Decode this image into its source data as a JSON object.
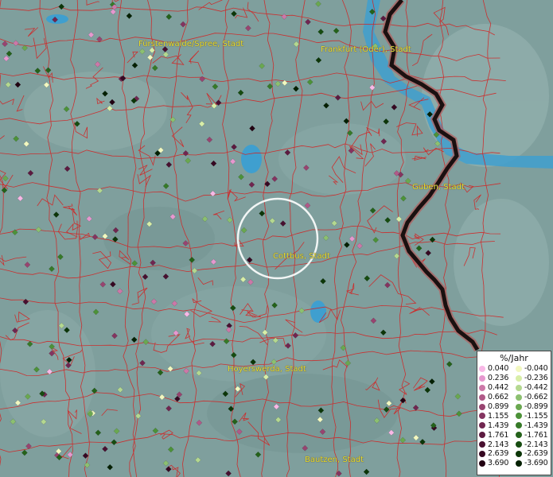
{
  "colors": {
    "background": "#7f9f9d",
    "water": "#3f9fcf",
    "border_line": "#d22424",
    "national_border": "#1a1010",
    "national_border_halo": "#b06060",
    "label": "#e8dd2a",
    "highlight_ring": "#ffffff"
  },
  "cities": [
    {
      "name": "Fürstenwalde/Spree, Stadt"
    },
    {
      "name": "Frankfurt (Oder), Stadt"
    },
    {
      "name": "Guben, Stadt"
    },
    {
      "name": "Cottbus, Stadt"
    },
    {
      "name": "Hoyerswerda, Stadt"
    },
    {
      "name": "Bautzen, Stadt"
    }
  ],
  "legend": {
    "title": "%/Jahr",
    "positive": [
      {
        "value": "0.040",
        "color": "#f8b8e6"
      },
      {
        "value": "0.236",
        "color": "#e698cf"
      },
      {
        "value": "0.442",
        "color": "#cc78a8"
      },
      {
        "value": "0.662",
        "color": "#b05a88"
      },
      {
        "value": "0.899",
        "color": "#984470"
      },
      {
        "value": "1.155",
        "color": "#843460"
      },
      {
        "value": "1.439",
        "color": "#702650"
      },
      {
        "value": "1.761",
        "color": "#5c1a40"
      },
      {
        "value": "2.143",
        "color": "#481030"
      },
      {
        "value": "2.639",
        "color": "#360822"
      },
      {
        "value": "3.690",
        "color": "#220212"
      }
    ],
    "negative": [
      {
        "value": "-0.040",
        "color": "#f2f8c0"
      },
      {
        "value": "-0.236",
        "color": "#d8eea8"
      },
      {
        "value": "-0.442",
        "color": "#b4d890"
      },
      {
        "value": "-0.662",
        "color": "#8cc070"
      },
      {
        "value": "-0.899",
        "color": "#6aa850"
      },
      {
        "value": "-1.155",
        "color": "#4c9238"
      },
      {
        "value": "-1.439",
        "color": "#367a28"
      },
      {
        "value": "-1.761",
        "color": "#24621a"
      },
      {
        "value": "-2.143",
        "color": "#164c10"
      },
      {
        "value": "-2.639",
        "color": "#0c3608"
      },
      {
        "value": "-3.690",
        "color": "#042002"
      }
    ]
  }
}
